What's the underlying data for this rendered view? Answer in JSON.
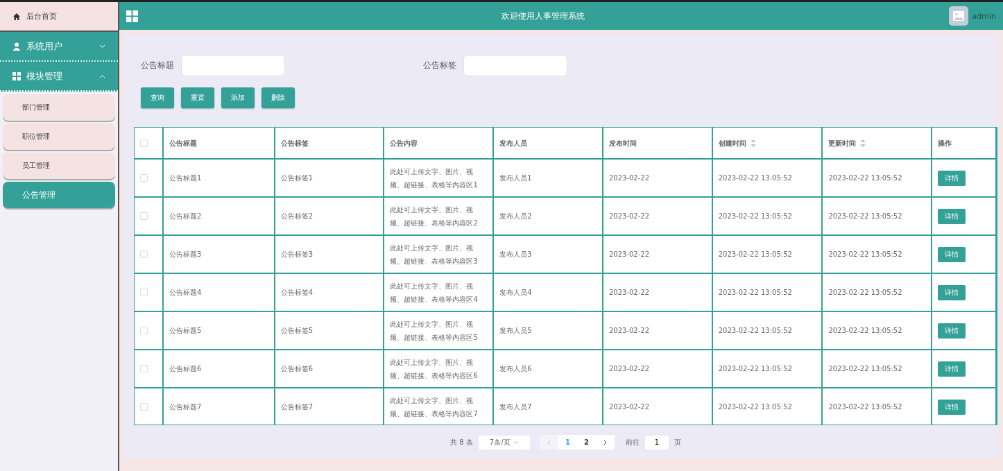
{
  "sidebar": {
    "items": [
      {
        "label": "后台首页",
        "kind": "home",
        "selected": false
      },
      {
        "label": "系统用户",
        "kind": "user",
        "expanded": false
      },
      {
        "label": "模块管理",
        "kind": "grid",
        "expanded": true,
        "children": [
          {
            "label": "部门管理",
            "selected": false
          },
          {
            "label": "职位管理",
            "selected": false
          },
          {
            "label": "员工管理",
            "selected": false
          },
          {
            "label": "公告管理",
            "selected": true
          }
        ]
      }
    ]
  },
  "header": {
    "title": "欢迎使用人事管理系统",
    "user": "admin"
  },
  "search": {
    "fields": [
      {
        "label": "公告标题"
      },
      {
        "label": "公告标签"
      }
    ],
    "buttons": [
      "查询",
      "重置",
      "添加",
      "删除"
    ]
  },
  "table": {
    "all_checked": false,
    "columns": [
      {
        "label": "公告标题",
        "sortable": false
      },
      {
        "label": "公告标签",
        "sortable": false
      },
      {
        "label": "公告内容",
        "sortable": false
      },
      {
        "label": "发布人员",
        "sortable": false
      },
      {
        "label": "发布时间",
        "sortable": false
      },
      {
        "label": "创建时间",
        "sortable": true
      },
      {
        "label": "更新时间",
        "sortable": true
      },
      {
        "label": "操作",
        "sortable": false
      }
    ],
    "rows": [
      {
        "checked": false,
        "cells": [
          "公告标题1",
          "公告标签1",
          "此处可上传文字、图片、视频、超链接、表格等内容区1",
          "发布人员1",
          "2023-02-22",
          "2023-02-22 13:05:52",
          "2023-02-22 13:05:52"
        ],
        "action": "详情"
      },
      {
        "checked": false,
        "cells": [
          "公告标题2",
          "公告标签2",
          "此处可上传文字、图片、视频、超链接、表格等内容区2",
          "发布人员2",
          "2023-02-22",
          "2023-02-22 13:05:52",
          "2023-02-22 13:05:52"
        ],
        "action": "详情"
      },
      {
        "checked": false,
        "cells": [
          "公告标题3",
          "公告标签3",
          "此处可上传文字、图片、视频、超链接、表格等内容区3",
          "发布人员3",
          "2023-02-22",
          "2023-02-22 13:05:52",
          "2023-02-22 13:05:52"
        ],
        "action": "详情"
      },
      {
        "checked": false,
        "cells": [
          "公告标题4",
          "公告标签4",
          "此处可上传文字、图片、视频、超链接、表格等内容区4",
          "发布人员4",
          "2023-02-22",
          "2023-02-22 13:05:52",
          "2023-02-22 13:05:52"
        ],
        "action": "详情"
      },
      {
        "checked": false,
        "cells": [
          "公告标题5",
          "公告标签5",
          "此处可上传文字、图片、视频、超链接、表格等内容区5",
          "发布人员5",
          "2023-02-22",
          "2023-02-22 13:05:52",
          "2023-02-22 13:05:52"
        ],
        "action": "详情"
      },
      {
        "checked": false,
        "cells": [
          "公告标题6",
          "公告标签6",
          "此处可上传文字、图片、视频、超链接、表格等内容区6",
          "发布人员6",
          "2023-02-22",
          "2023-02-22 13:05:52",
          "2023-02-22 13:05:52"
        ],
        "action": "详情"
      },
      {
        "checked": false,
        "cells": [
          "公告标题7",
          "公告标签7",
          "此处可上传文字、图片、视频、超链接、表格等内容区7",
          "发布人员7",
          "2023-02-22",
          "2023-02-22 13:05:52",
          "2023-02-22 13:05:52"
        ],
        "action": "详情"
      }
    ]
  },
  "pagination": {
    "total": "共 8 条",
    "page_size": "7条/页",
    "pages": [
      {
        "label": "1",
        "selected": true
      },
      {
        "label": "2",
        "selected": false
      }
    ],
    "goto_label": "前往",
    "goto_value": "1",
    "goto_suffix": "页"
  }
}
